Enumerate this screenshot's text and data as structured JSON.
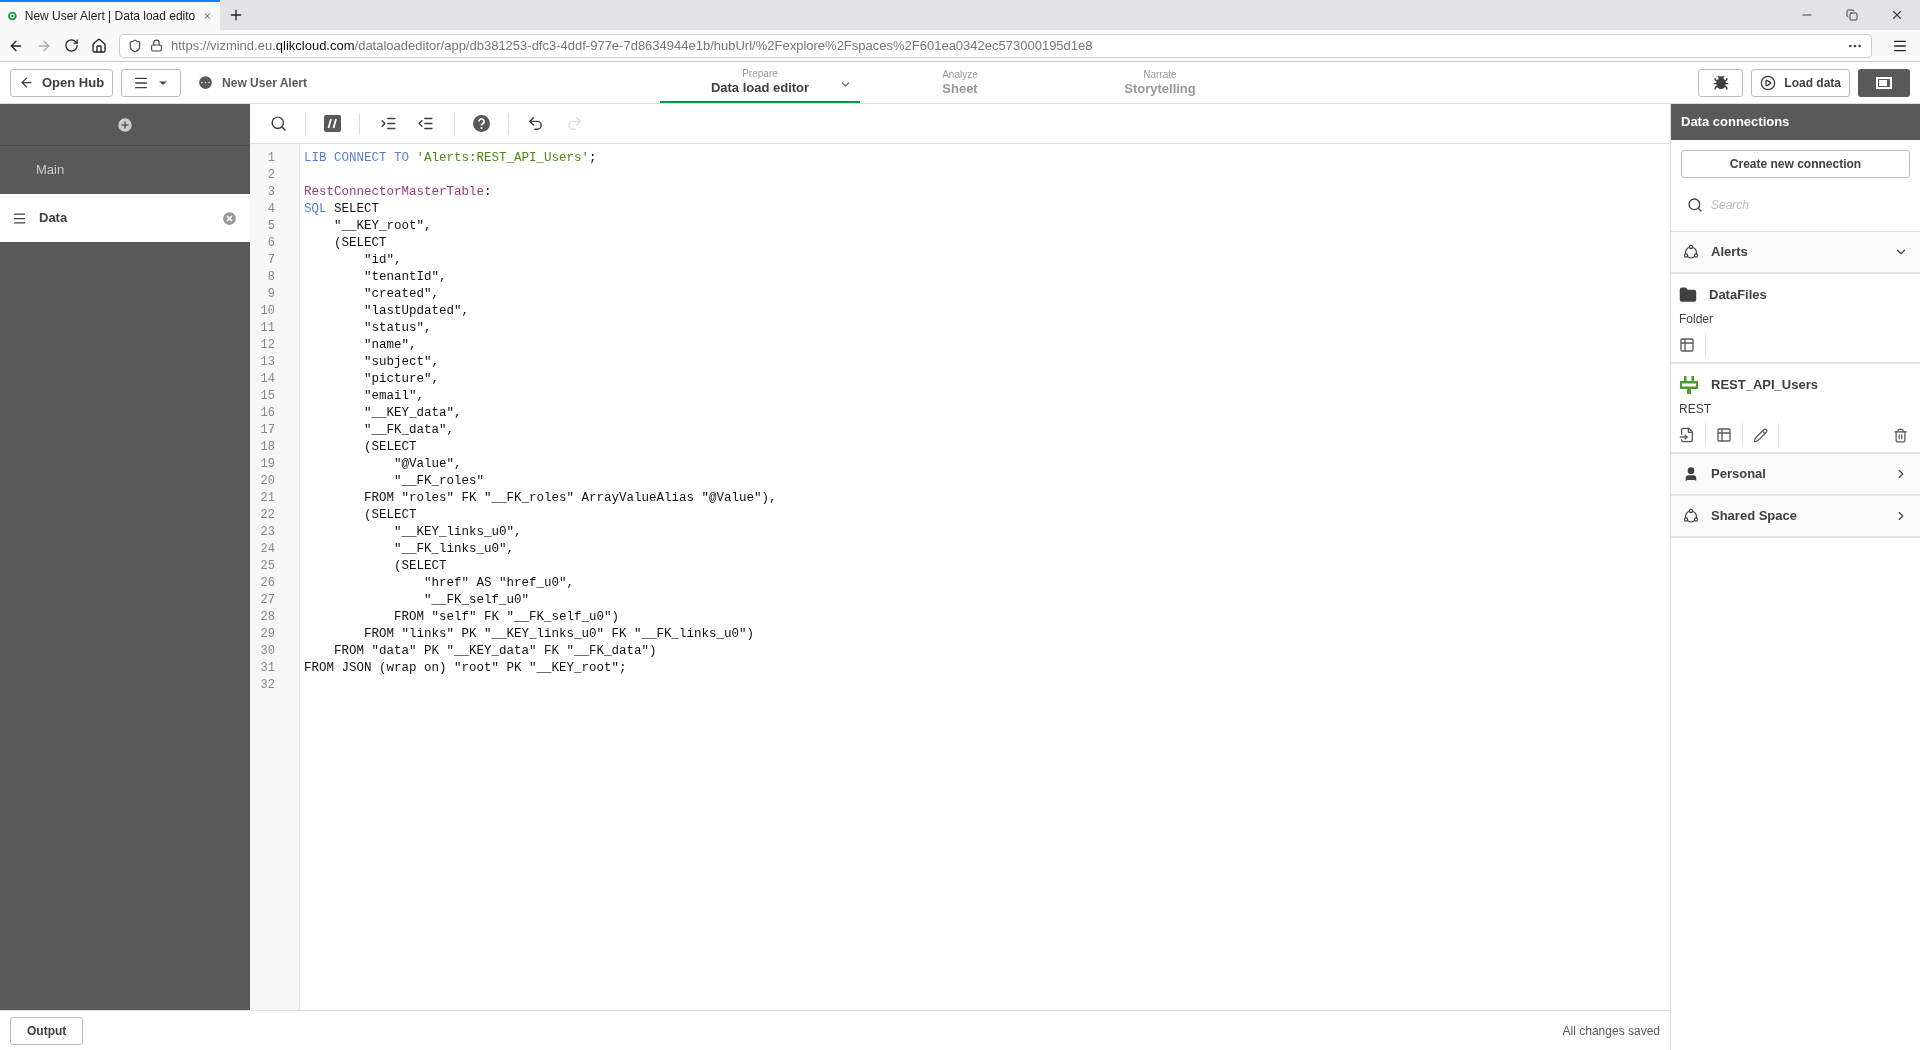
{
  "browser": {
    "tab_title": "New User Alert | Data load edito",
    "url": {
      "scheme_host": "https://vizmind.eu.",
      "domain": "qlikcloud.com",
      "path": "/dataloadeditor/app/db381253-dfc3-4ddf-977e-7d8634944e1b/hubUrl/%2Fexplore%2Fspaces%2F601ea0342ec573000195d1e8"
    }
  },
  "header": {
    "open_hub": "Open Hub",
    "app_name": "New User Alert",
    "nav_tabs": [
      {
        "caption": "Prepare",
        "label": "Data load editor",
        "selected": true,
        "dropdown": true
      },
      {
        "caption": "Analyze",
        "label": "Sheet",
        "selected": false,
        "dropdown": false
      },
      {
        "caption": "Narrate",
        "label": "Storytelling",
        "selected": false,
        "dropdown": false
      }
    ],
    "load_data": "Load data"
  },
  "sections": [
    {
      "label": "Main",
      "selected": false
    },
    {
      "label": "Data",
      "selected": true
    }
  ],
  "editor": {
    "lines": [
      {
        "number": "1",
        "tokens": [
          {
            "kind": "keyword",
            "text": "LIB CONNECT TO "
          },
          {
            "kind": "string",
            "text": "'Alerts:REST_API_Users'"
          },
          {
            "kind": "plain",
            "text": ";"
          }
        ]
      },
      {
        "number": "2"
      },
      {
        "number": "3",
        "tokens": [
          {
            "kind": "label",
            "text": "RestConnectorMasterTable"
          },
          {
            "kind": "plain",
            "text": ":"
          }
        ]
      },
      {
        "number": "4",
        "tokens": [
          {
            "kind": "keyword",
            "text": "SQL"
          },
          {
            "kind": "plain",
            "text": " SELECT"
          }
        ]
      },
      {
        "number": "5",
        "tokens": [
          {
            "kind": "plain",
            "text": "    \"__KEY_root\","
          }
        ]
      },
      {
        "number": "6",
        "tokens": [
          {
            "kind": "plain",
            "text": "    (SELECT"
          }
        ]
      },
      {
        "number": "7",
        "tokens": [
          {
            "kind": "plain",
            "text": "        \"id\","
          }
        ]
      },
      {
        "number": "8",
        "tokens": [
          {
            "kind": "plain",
            "text": "        \"tenantId\","
          }
        ]
      },
      {
        "number": "9",
        "tokens": [
          {
            "kind": "plain",
            "text": "        \"created\","
          }
        ]
      },
      {
        "number": "10",
        "tokens": [
          {
            "kind": "plain",
            "text": "        \"lastUpdated\","
          }
        ]
      },
      {
        "number": "11",
        "tokens": [
          {
            "kind": "plain",
            "text": "        \"status\","
          }
        ]
      },
      {
        "number": "12",
        "tokens": [
          {
            "kind": "plain",
            "text": "        \"name\","
          }
        ]
      },
      {
        "number": "13",
        "tokens": [
          {
            "kind": "plain",
            "text": "        \"subject\","
          }
        ]
      },
      {
        "number": "14",
        "tokens": [
          {
            "kind": "plain",
            "text": "        \"picture\","
          }
        ]
      },
      {
        "number": "15",
        "tokens": [
          {
            "kind": "plain",
            "text": "        \"email\","
          }
        ]
      },
      {
        "number": "16",
        "tokens": [
          {
            "kind": "plain",
            "text": "        \"__KEY_data\","
          }
        ]
      },
      {
        "number": "17",
        "tokens": [
          {
            "kind": "plain",
            "text": "        \"__FK_data\","
          }
        ]
      },
      {
        "number": "18",
        "tokens": [
          {
            "kind": "plain",
            "text": "        (SELECT"
          }
        ]
      },
      {
        "number": "19",
        "tokens": [
          {
            "kind": "plain",
            "text": "            \"@Value\","
          }
        ]
      },
      {
        "number": "20",
        "tokens": [
          {
            "kind": "plain",
            "text": "            \"__FK_roles\""
          }
        ]
      },
      {
        "number": "21",
        "tokens": [
          {
            "kind": "plain",
            "text": "        FROM \"roles\" FK \"__FK_roles\" ArrayValueAlias \"@Value\"),"
          }
        ]
      },
      {
        "number": "22",
        "tokens": [
          {
            "kind": "plain",
            "text": "        (SELECT"
          }
        ]
      },
      {
        "number": "23",
        "tokens": [
          {
            "kind": "plain",
            "text": "            \"__KEY_links_u0\","
          }
        ]
      },
      {
        "number": "24",
        "tokens": [
          {
            "kind": "plain",
            "text": "            \"__FK_links_u0\","
          }
        ]
      },
      {
        "number": "25",
        "tokens": [
          {
            "kind": "plain",
            "text": "            (SELECT"
          }
        ]
      },
      {
        "number": "26",
        "tokens": [
          {
            "kind": "plain",
            "text": "                \"href\" AS \"href_u0\","
          }
        ]
      },
      {
        "number": "27",
        "tokens": [
          {
            "kind": "plain",
            "text": "                \"__FK_self_u0\""
          }
        ]
      },
      {
        "number": "28",
        "tokens": [
          {
            "kind": "plain",
            "text": "            FROM \"self\" FK \"__FK_self_u0\")"
          }
        ]
      },
      {
        "number": "29",
        "tokens": [
          {
            "kind": "plain",
            "text": "        FROM \"links\" PK \"__KEY_links_u0\" FK \"__FK_links_u0\")"
          }
        ]
      },
      {
        "number": "30",
        "tokens": [
          {
            "kind": "plain",
            "text": "    FROM \"data\" PK \"__KEY_data\" FK \"__FK_data\")"
          }
        ]
      },
      {
        "number": "31",
        "tokens": [
          {
            "kind": "plain",
            "text": "FROM JSON (wrap on) \"root\" PK \"__KEY_root\";"
          }
        ]
      },
      {
        "number": "32"
      }
    ]
  },
  "footer": {
    "output": "Output",
    "status": "All changes saved"
  },
  "connections_panel": {
    "title": "Data connections",
    "create": "Create new connection",
    "search": {
      "placeholder": "Search"
    },
    "spaces": [
      {
        "name": "Alerts",
        "kind": "shared",
        "expanded": true,
        "connections": [
          {
            "name": "DataFiles",
            "type": "Folder",
            "kind": "folder"
          },
          {
            "name": "REST_API_Users",
            "type": "REST",
            "kind": "rest"
          }
        ]
      },
      {
        "name": "Personal",
        "kind": "personal",
        "expanded": false
      },
      {
        "name": "Shared Space",
        "kind": "shared",
        "expanded": false
      }
    ]
  }
}
